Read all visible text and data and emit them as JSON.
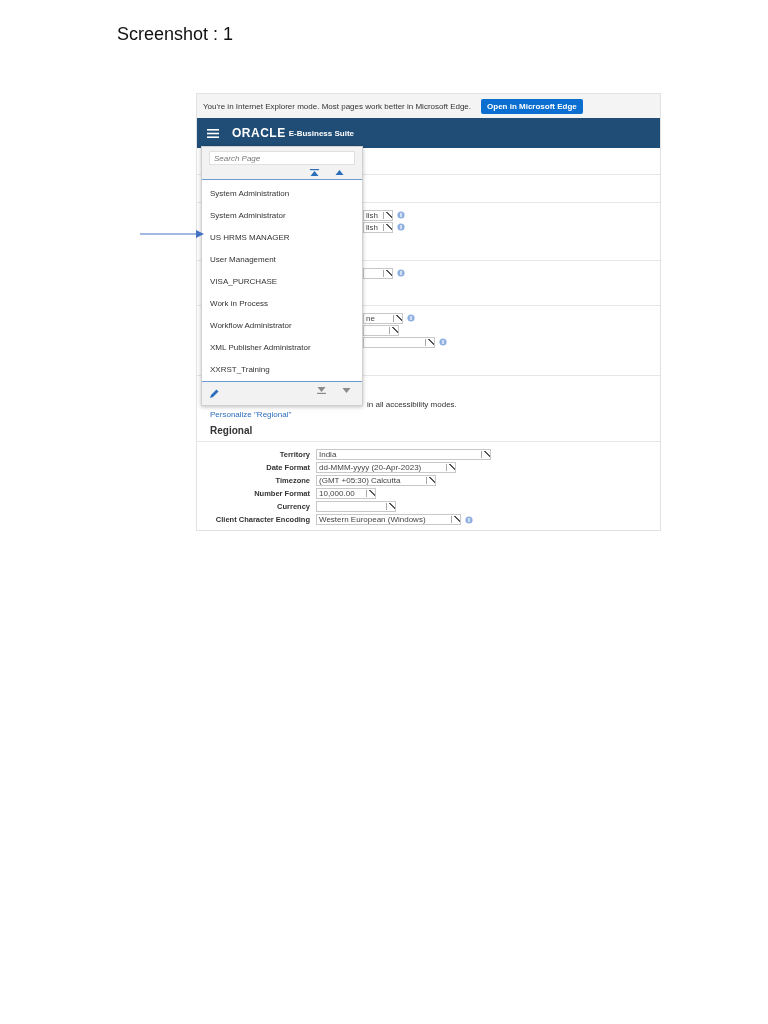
{
  "document": {
    "heading": "Screenshot : 1"
  },
  "ie_bar": {
    "message": "You're in Internet Explorer mode. Most pages work better in Microsoft Edge.",
    "button": "Open in Microsoft Edge"
  },
  "header": {
    "logo": "ORACLE",
    "product": "E-Business Suite"
  },
  "field_groups": [
    {
      "fields": [
        {
          "value": "lish",
          "info": true
        },
        {
          "value": "lish",
          "info": true
        }
      ]
    },
    {
      "fields": [
        {
          "info": true
        }
      ]
    },
    {
      "fields": [
        {
          "value": "ne",
          "info": true
        },
        {
          "info": false
        },
        {
          "info": true
        }
      ]
    }
  ],
  "note": "in all accessibility modes.",
  "personalize_link": "Personalize \"Regional\"",
  "regional": {
    "title": "Regional",
    "rows": [
      {
        "label": "Territory",
        "value": "India",
        "info": false
      },
      {
        "label": "Date Format",
        "value": "dd-MMM-yyyy (20-Apr-2023)",
        "info": false
      },
      {
        "label": "Timezone",
        "value": "(GMT +05:30) Calcutta",
        "info": false
      },
      {
        "label": "Number Format",
        "value": "10,000.00",
        "info": false
      },
      {
        "label": "Currency",
        "info": false
      },
      {
        "label": "Client Character Encoding",
        "value": "Western European (Windows)",
        "info": true
      }
    ]
  },
  "menu": {
    "search": {
      "placeholder": "Search Page"
    },
    "items": [
      "System Administration",
      "System Administrator",
      "US HRMS MANAGER",
      "User Management",
      "VISA_PURCHASE",
      "Work in Process",
      "Workflow Administrator",
      "XML Publisher Administrator",
      "XXRST_Training"
    ]
  }
}
